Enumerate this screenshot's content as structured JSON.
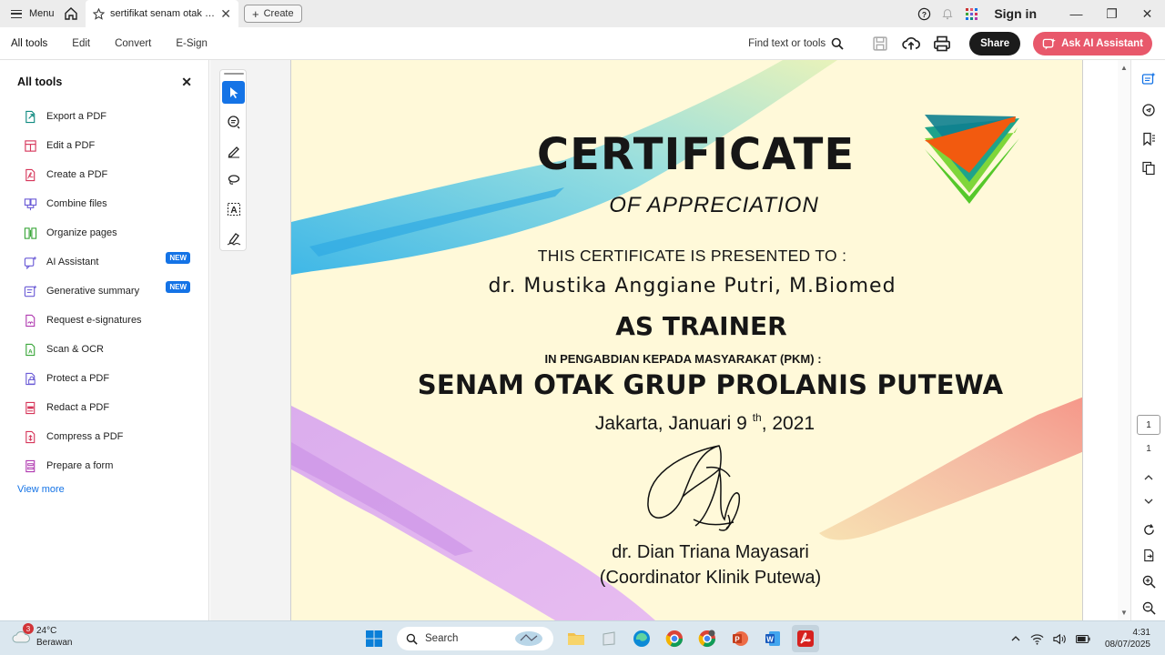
{
  "titlebar": {
    "menu_label": "Menu",
    "tab_title": "sertifikat senam otak dr...",
    "create_label": "Create",
    "sign_in": "Sign in"
  },
  "toolbar": {
    "tabs": [
      "All tools",
      "Edit",
      "Convert",
      "E-Sign"
    ],
    "find_label": "Find text or tools",
    "share_label": "Share",
    "ai_label": "Ask AI Assistant"
  },
  "leftpanel": {
    "title": "All tools",
    "items": [
      {
        "label": "Export a PDF",
        "icon": "export-pdf-icon",
        "color": "#0f8a80"
      },
      {
        "label": "Edit a PDF",
        "icon": "edit-pdf-icon",
        "color": "#d6365a"
      },
      {
        "label": "Create a PDF",
        "icon": "create-pdf-icon",
        "color": "#d6365a"
      },
      {
        "label": "Combine files",
        "icon": "combine-files-icon",
        "color": "#6b5bd6"
      },
      {
        "label": "Organize pages",
        "icon": "organize-pages-icon",
        "color": "#3aa63a"
      },
      {
        "label": "AI Assistant",
        "icon": "ai-assistant-icon",
        "color": "#6b5bd6",
        "badge": "NEW"
      },
      {
        "label": "Generative summary",
        "icon": "generative-summary-icon",
        "color": "#6b5bd6",
        "badge": "NEW"
      },
      {
        "label": "Request e-signatures",
        "icon": "request-esignatures-icon",
        "color": "#b03ab0"
      },
      {
        "label": "Scan & OCR",
        "icon": "scan-ocr-icon",
        "color": "#3aa63a"
      },
      {
        "label": "Protect a PDF",
        "icon": "protect-pdf-icon",
        "color": "#6b5bd6"
      },
      {
        "label": "Redact a PDF",
        "icon": "redact-pdf-icon",
        "color": "#d6365a"
      },
      {
        "label": "Compress a PDF",
        "icon": "compress-pdf-icon",
        "color": "#d6365a"
      },
      {
        "label": "Prepare a form",
        "icon": "prepare-form-icon",
        "color": "#b03ab0"
      }
    ],
    "view_more": "View more"
  },
  "certificate": {
    "title": "CERTIFICATE",
    "subtitle": "OF APPRECIATION",
    "presented": "THIS CERTIFICATE IS PRESENTED TO :",
    "recipient": "dr. Mustika Anggiane Putri, M.Biomed",
    "role": "AS TRAINER",
    "in_line": "IN  PENGABDIAN KEPADA MASYARAKAT (PKM) :",
    "event": "SENAM OTAK GRUP PROLANIS PUTEWA",
    "date_main": "Jakarta, Januari 9",
    "date_sup": "th",
    "date_year": ", 2021",
    "signer": "dr. Dian Triana Mayasari",
    "signer_title": "(Coordinator Klinik Putewa)"
  },
  "page_nav": {
    "current": "1",
    "total": "1"
  },
  "taskbar": {
    "weather_temp": "24°C",
    "weather_desc": "Berawan",
    "weather_badge": "3",
    "search_label": "Search",
    "time": "4:31",
    "date": "08/07/2025"
  },
  "colors": {
    "accent": "#1473e6",
    "ai": "#e8586b",
    "doc_bg": "#fff9d9"
  }
}
